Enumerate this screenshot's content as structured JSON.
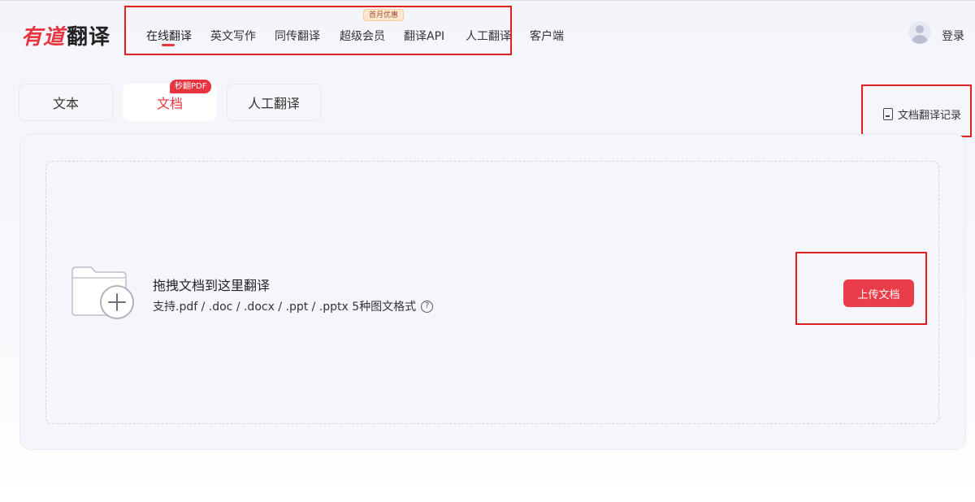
{
  "header": {
    "logo_brand": "有道",
    "logo_product": "翻译",
    "nav": [
      {
        "label": "在线翻译",
        "active": true
      },
      {
        "label": "英文写作"
      },
      {
        "label": "同传翻译"
      },
      {
        "label": "超级会员"
      },
      {
        "label": "翻译API"
      },
      {
        "label": "人工翻译"
      },
      {
        "label": "客户端"
      }
    ],
    "promo_badge": "首月优惠",
    "login": "登录"
  },
  "tabs": [
    {
      "label": "文本"
    },
    {
      "label": "文档",
      "active": true
    },
    {
      "label": "人工翻译"
    }
  ],
  "tab_badge": "秒翻PDF",
  "history_link": "文档翻译记录",
  "dropzone": {
    "title": "拖拽文档到这里翻译",
    "subtitle": "支持.pdf / .doc / .docx / .ppt / .pptx 5种图文格式",
    "help_symbol": "?",
    "upload_button": "上传文档"
  },
  "colors": {
    "accent": "#e8343f",
    "highlight_box": "#e02020"
  }
}
